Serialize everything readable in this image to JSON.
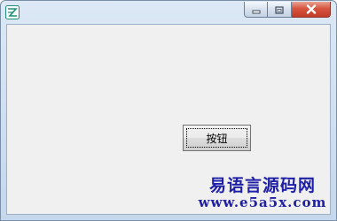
{
  "window": {
    "title": ""
  },
  "client": {
    "button_label": "按钮"
  },
  "watermark": {
    "title": "易语言源码网",
    "url": "www.e5a5x.com"
  },
  "colors": {
    "titlebar": "#c9dbee",
    "client_bg": "#f0f0f0",
    "close_button": "#c94a35",
    "watermark_text": "#1e1ea8"
  },
  "icons": {
    "app": "app-logo-icon",
    "minimize": "minimize-icon",
    "maximize": "maximize-icon",
    "close": "close-icon"
  }
}
